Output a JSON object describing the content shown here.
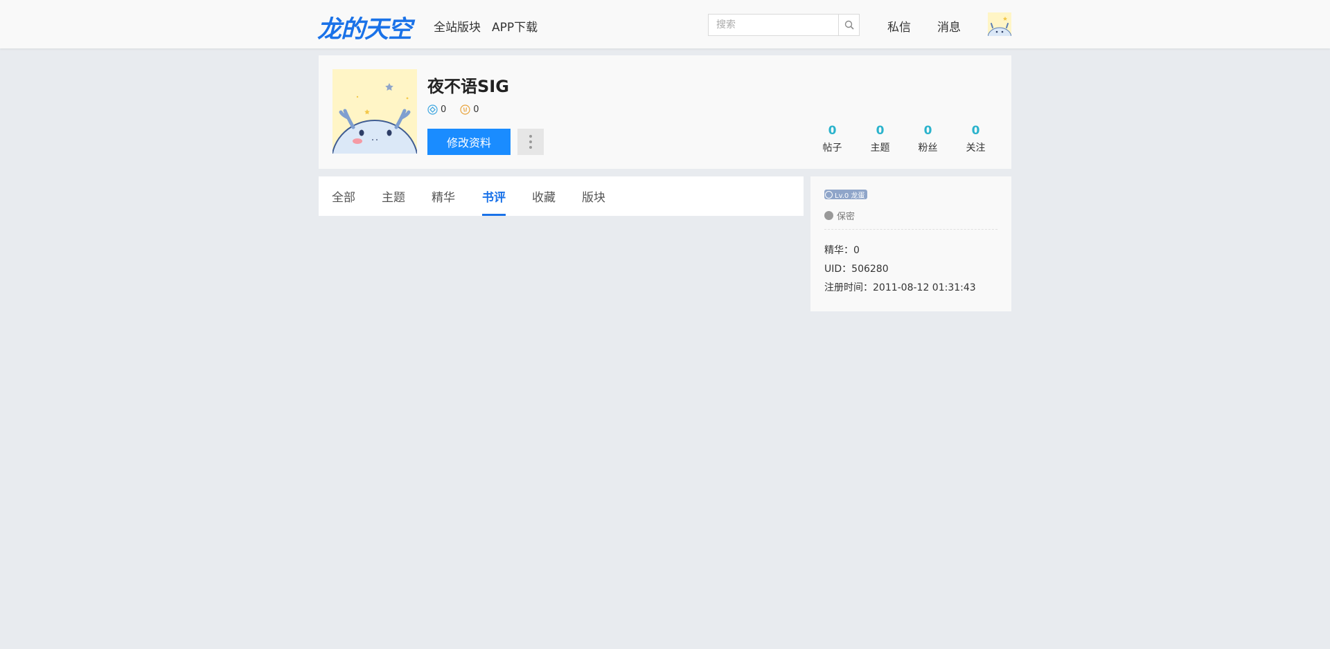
{
  "header": {
    "logo": "龙的天空",
    "nav": [
      "全站版块",
      "APP下载"
    ],
    "search_placeholder": "搜索",
    "links": [
      "私信",
      "消息"
    ]
  },
  "profile": {
    "username": "夜不语SIG",
    "stat_a": "0",
    "stat_b": "0",
    "edit_label": "修改资料",
    "counts": [
      {
        "num": "0",
        "label": "帖子"
      },
      {
        "num": "0",
        "label": "主题"
      },
      {
        "num": "0",
        "label": "粉丝"
      },
      {
        "num": "0",
        "label": "关注"
      }
    ]
  },
  "tabs": [
    "全部",
    "主题",
    "精华",
    "书评",
    "收藏",
    "版块"
  ],
  "active_tab": "书评",
  "info": {
    "level": "Lv.0 龙蛋",
    "gender": "保密",
    "rows": [
      {
        "key": "精华：",
        "value": "0"
      },
      {
        "key": "UID：",
        "value": "506280"
      },
      {
        "key": "注册时间：",
        "value": "2011-08-12 01:31:43"
      }
    ]
  },
  "colors": {
    "brand": "#1a72e8",
    "button": "#1a8cff",
    "count": "#2bb3cc",
    "background": "#e8ebef"
  }
}
